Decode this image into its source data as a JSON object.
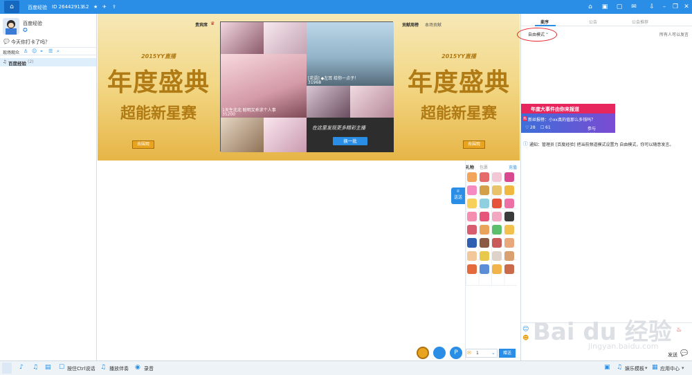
{
  "titlebar": {
    "name": "百度经验",
    "id": "ID 26442913",
    "online": "2"
  },
  "user": {
    "name": "百度经验",
    "status": "今天你打卡了吗？"
  },
  "left": {
    "section": "现场观众",
    "channel": "百度经验",
    "channel_count": "(2)"
  },
  "stage": {
    "left_banner": {
      "title": "年度盛典",
      "subtitle": "超能新星赛",
      "year": "2015YY直播",
      "button": "去围观"
    },
    "right_banner": {
      "title": "年度盛典",
      "subtitle": "超能新星赛",
      "year": "2015YY直播",
      "button": "去围观"
    },
    "vip_label": "贵宾席",
    "contrib_label": "贡献周榜",
    "contrib_tab": "本场贡献",
    "cards": [
      {
        "title": "[花语] ◆左耳 给你一点子！",
        "count": "31968"
      },
      {
        "title": "1天生北北 聪明又乖求个人事",
        "count": "35200"
      }
    ],
    "promo": "在这里发现更多精彩主播",
    "refresh": "换一批"
  },
  "right": {
    "tabs": [
      "麦序",
      "公告",
      "公会推荐"
    ],
    "mode": "自由模式",
    "mode_note": "所有人可以发言",
    "ad": {
      "title": "年度大事件由你来报道",
      "line": "新丝报榜：小xx真的值那么多钱吗？",
      "likes": "28",
      "comments": "61",
      "link": "参与讨论>>"
    },
    "notice": "通知：管理员 [百度经验] 把当前频道模式设置为 自由模式，你可以随意发言。",
    "send": "发送"
  },
  "gifts": {
    "tab_gift": "礼物",
    "tab_pack": "包裹",
    "recharge": "充值",
    "send_btn": "送送",
    "qty": "1",
    "give": "赠送"
  },
  "bottom": {
    "ctrl": "按住Ctrl说话",
    "music": "播放伴奏",
    "record": "录音",
    "entertainment": "娱乐模板",
    "app_center": "应用中心"
  },
  "watermark": {
    "text": "Bai du 经验",
    "url": "jingyan.baidu.com"
  },
  "colors": {
    "accent": "#2a8ee6",
    "gold": "#e8a41e",
    "pink": "#e8265e",
    "purple": "#7a4bd2"
  }
}
